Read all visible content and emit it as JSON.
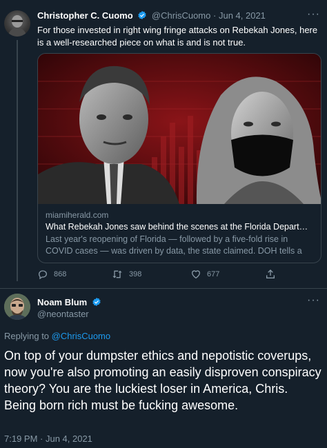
{
  "tweet": {
    "author_name": "Christopher C. Cuomo",
    "author_handle": "@ChrisCuomo",
    "separator": "·",
    "date": "Jun 4, 2021",
    "text": "For those invested in right wing fringe attacks on Rebekah Jones, here is a well-researched piece on what is and is not true.",
    "more": "···",
    "card": {
      "domain": "miamiherald.com",
      "title": "What Rebekah Jones saw behind the scenes at the Florida Departmen...",
      "description": "Last year's reopening of Florida — followed by a five-fold rise in COVID cases — was driven by data, the state claimed. DOH tells a different ..."
    },
    "actions": {
      "replies": "868",
      "retweets": "398",
      "likes": "677"
    }
  },
  "reply": {
    "author_name": "Noam Blum",
    "author_handle": "@neontaster",
    "more": "···",
    "replying_to_prefix": "Replying to",
    "replying_to_handle": "@ChrisCuomo",
    "text": "On top of your dumpster ethics and nepotistic coverups, now you're also promoting an easily disproven conspiracy theory? You are the luckiest loser in America, Chris. Being born rich must be fucking awesome.",
    "timestamp": "7:19 PM · Jun 4, 2021"
  },
  "colors": {
    "background": "#15202b",
    "border": "#38444d",
    "muted": "#8899a6",
    "link": "#1d9bf0",
    "verified": "#1d9bf0",
    "card_image_bg": "#5a0b0e"
  }
}
